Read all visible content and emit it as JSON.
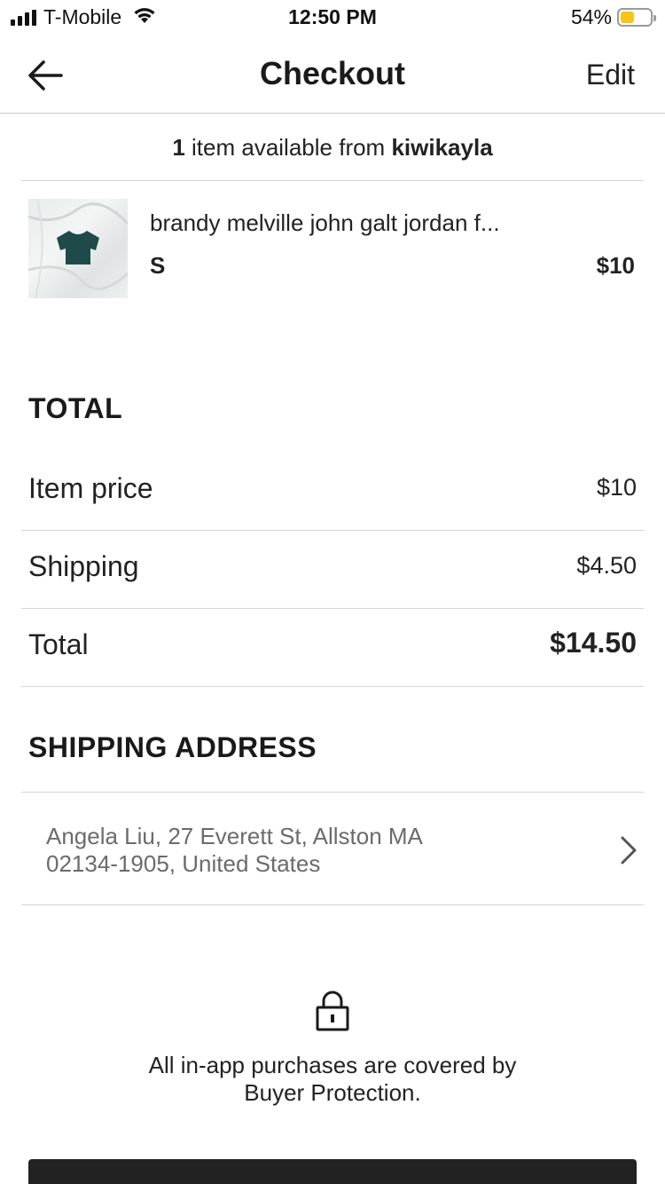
{
  "status_bar": {
    "carrier": "T-Mobile",
    "time": "12:50 PM",
    "battery_percent": "54%",
    "battery_level": 0.54,
    "battery_color": "#f5c518"
  },
  "nav": {
    "back_icon": "arrow-left-icon",
    "title": "Checkout",
    "edit_label": "Edit"
  },
  "seller": {
    "count": "1",
    "text": " item available from ",
    "name": "kiwikayla"
  },
  "item": {
    "title": "brandy melville john galt jordan f...",
    "size": "S",
    "price": "$10",
    "thumb_shirt_color": "#1f4a4a"
  },
  "total": {
    "heading": "TOTAL",
    "rows": [
      {
        "label": "Item price",
        "value": "$10"
      },
      {
        "label": "Shipping",
        "value": "$4.50"
      },
      {
        "label": "Total",
        "value": "$14.50"
      }
    ]
  },
  "shipping_address": {
    "heading": "SHIPPING ADDRESS",
    "line1": "Angela Liu, 27 Everett St, Allston MA",
    "line2": "02134-1905, United States",
    "chevron_icon": "chevron-right-icon"
  },
  "protection": {
    "icon": "lock-icon",
    "text_line1": "All in-app purchases are covered by",
    "text_line2": "Buyer Protection."
  }
}
